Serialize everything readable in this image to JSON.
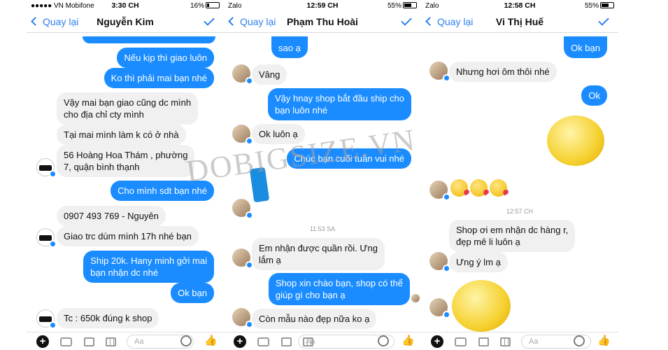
{
  "panels": [
    {
      "status": {
        "carrier": "●●●●● VN Mobifone",
        "time": "3:30 CH",
        "battery": "16%"
      },
      "nav": {
        "back": "Quay lại",
        "title": "Nguyễn Kim"
      },
      "messages": [
        {
          "dir": "out",
          "text": [
            "Nếu kịp thì giao luôn"
          ]
        },
        {
          "dir": "out",
          "text": [
            "Ko thì phải mai bạn nhé"
          ]
        },
        {
          "dir": "in",
          "text": [
            "Vậy mai bạn giao cũng dc mình",
            "cho địa chỉ cty mình"
          ]
        },
        {
          "dir": "in",
          "text": [
            "Tại mai mình làm k có ở nhà"
          ]
        },
        {
          "dir": "in",
          "text": [
            "56 Hoàng Hoa Thám , phường",
            "7, quận bình thạnh"
          ]
        },
        {
          "dir": "out",
          "text": [
            "Cho mình sdt bạn nhé"
          ]
        },
        {
          "dir": "in",
          "text": [
            "0907 493 769 - Nguyên"
          ]
        },
        {
          "dir": "in",
          "text": [
            "Giao trc dùm mình 17h nhé bạn"
          ]
        },
        {
          "dir": "out",
          "text": [
            "Ship 20k. Hany minh gởi mai",
            "bạn nhận dc nhé"
          ]
        },
        {
          "dir": "out",
          "text": [
            "Ok bạn"
          ]
        },
        {
          "dir": "in",
          "text": [
            "Tc : 650k đúng k shop"
          ]
        }
      ],
      "composer_placeholder": "Aa"
    },
    {
      "status": {
        "carrier": "Zalo",
        "time": "12:59 CH",
        "battery": "55%"
      },
      "nav": {
        "back": "Quay lại",
        "title": "Phạm Thu Hoài"
      },
      "messages": [
        {
          "dir": "out",
          "text": [
            "sao ạ"
          ]
        },
        {
          "dir": "in",
          "text": [
            "Vâng"
          ]
        },
        {
          "dir": "out",
          "text": [
            "Vậy hnay shop bắt đầu ship cho",
            "bạn luôn nhé"
          ]
        },
        {
          "dir": "in",
          "text": [
            "Ok luôn ạ"
          ]
        },
        {
          "dir": "out",
          "text": [
            "Chúc bạn cuối tuần vui nhé"
          ]
        },
        {
          "dir": "time",
          "text": [
            "11:53 SA"
          ]
        },
        {
          "dir": "in",
          "text": [
            "Em nhận được quần rồi. Ưng",
            "lắm ạ"
          ]
        },
        {
          "dir": "out",
          "text": [
            "Shop xin chào bạn, shop có thể",
            "giúp gì cho bạn ạ"
          ]
        },
        {
          "dir": "in",
          "text": [
            "Còn mẫu nào đẹp nữa ko ạ"
          ]
        }
      ],
      "composer_placeholder": "Aa"
    },
    {
      "status": {
        "carrier": "Zalo",
        "time": "12:58 CH",
        "battery": "55%"
      },
      "nav": {
        "back": "Quay lại",
        "title": "Vi Thị Huế"
      },
      "messages": [
        {
          "dir": "out",
          "text": [
            "Ok bạn"
          ]
        },
        {
          "dir": "in",
          "text": [
            "Nhưng hơi ôm thôi nhé"
          ]
        },
        {
          "dir": "out",
          "text": [
            "Ok"
          ]
        },
        {
          "dir": "time",
          "text": [
            "12:57 CH"
          ]
        },
        {
          "dir": "in",
          "text": [
            "Shop ơi em nhận dc hàng r,",
            "đẹp mê li luôn ạ"
          ]
        },
        {
          "dir": "in",
          "text": [
            "Ưng ý lm ạ"
          ]
        }
      ],
      "composer_placeholder": "Aa"
    }
  ],
  "watermark": "DOBIGSIZE.VN",
  "colors": {
    "accent": "#1a8cff",
    "incoming": "#f0f0f1",
    "link": "#2f80ed"
  }
}
